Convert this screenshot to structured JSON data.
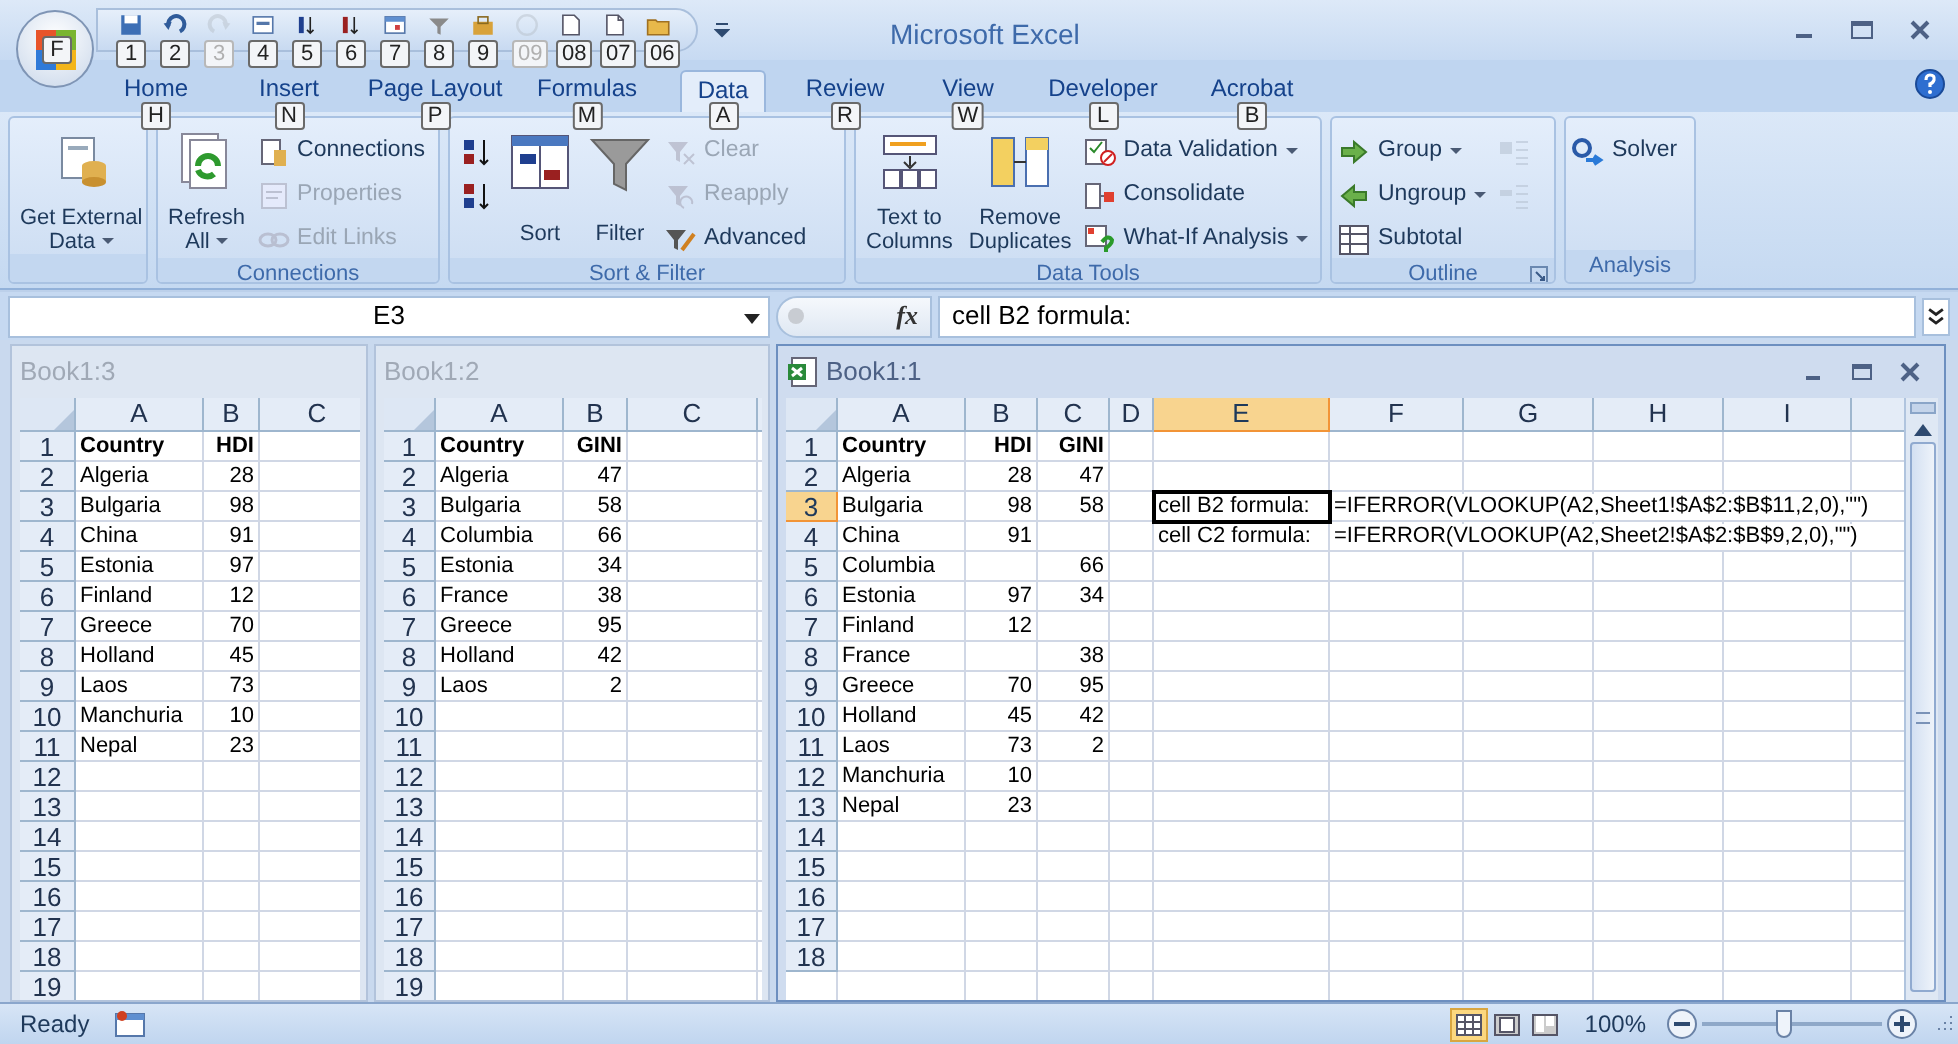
{
  "title_bar": {
    "title": "Microsoft Excel",
    "office_button_keytip": "F",
    "quick_access": [
      {
        "keytip": "1",
        "disabled": false
      },
      {
        "keytip": "2",
        "disabled": false
      },
      {
        "keytip": "3",
        "disabled": true
      },
      {
        "keytip": "4",
        "disabled": false
      },
      {
        "keytip": "5",
        "disabled": false
      },
      {
        "keytip": "6",
        "disabled": false
      },
      {
        "keytip": "7",
        "disabled": false
      },
      {
        "keytip": "8",
        "disabled": false
      },
      {
        "keytip": "9",
        "disabled": false
      },
      {
        "keytip": "09",
        "disabled": true
      },
      {
        "keytip": "08",
        "disabled": false
      },
      {
        "keytip": "07",
        "disabled": false
      },
      {
        "keytip": "06",
        "disabled": false
      }
    ]
  },
  "ribbon": {
    "tabs": [
      {
        "label": "Home",
        "keytip": "H",
        "selected": false
      },
      {
        "label": "Insert",
        "keytip": "N",
        "selected": false
      },
      {
        "label": "Page Layout",
        "keytip": "P",
        "selected": false
      },
      {
        "label": "Formulas",
        "keytip": "M",
        "selected": false
      },
      {
        "label": "Data",
        "keytip": "A",
        "selected": true
      },
      {
        "label": "Review",
        "keytip": "R",
        "selected": false
      },
      {
        "label": "View",
        "keytip": "W",
        "selected": false
      },
      {
        "label": "Developer",
        "keytip": "L",
        "selected": false
      },
      {
        "label": "Acrobat",
        "keytip": "B",
        "selected": false
      }
    ],
    "groups": [
      {
        "launcher": false,
        "commands": [
          {
            "kind": "large",
            "lines": [
              "Get External",
              "Data"
            ],
            "dropdown": true,
            "disabled": false
          }
        ]
      },
      {
        "label": "Connections",
        "launcher": false,
        "commands": [
          {
            "kind": "large",
            "lines": [
              "Refresh",
              "All"
            ],
            "dropdown": true,
            "disabled": false
          },
          {
            "kind": "small",
            "label": "Connections",
            "dropdown": false,
            "disabled": false
          },
          {
            "kind": "small",
            "label": "Properties",
            "dropdown": false,
            "disabled": true
          },
          {
            "kind": "small",
            "label": "Edit Links",
            "dropdown": false,
            "disabled": true
          }
        ]
      },
      {
        "label": "Sort & Filter",
        "launcher": false,
        "commands": [
          {
            "kind": "icon",
            "disabled": false
          },
          {
            "kind": "icon",
            "disabled": false
          },
          {
            "kind": "large",
            "lines": [
              "Sort"
            ],
            "dropdown": false,
            "disabled": false
          },
          {
            "kind": "large",
            "lines": [
              "Filter"
            ],
            "dropdown": false,
            "disabled": false
          },
          {
            "kind": "small",
            "label": "Clear",
            "dropdown": false,
            "disabled": true
          },
          {
            "kind": "small",
            "label": "Reapply",
            "dropdown": false,
            "disabled": true
          },
          {
            "kind": "small",
            "label": "Advanced",
            "dropdown": false,
            "disabled": false
          }
        ]
      },
      {
        "label": "Data Tools",
        "launcher": false,
        "commands": [
          {
            "kind": "large",
            "lines": [
              "Text to",
              "Columns"
            ],
            "dropdown": false,
            "disabled": false
          },
          {
            "kind": "large",
            "lines": [
              "Remove",
              "Duplicates"
            ],
            "dropdown": false,
            "disabled": false
          },
          {
            "kind": "small",
            "label": "Data Validation",
            "dropdown": true,
            "disabled": false
          },
          {
            "kind": "small",
            "label": "Consolidate",
            "dropdown": false,
            "disabled": false
          },
          {
            "kind": "small",
            "label": "What-If Analysis",
            "dropdown": true,
            "disabled": false
          }
        ]
      },
      {
        "label": "Outline",
        "launcher": true,
        "commands": [
          {
            "kind": "small",
            "label": "Group",
            "dropdown": true,
            "disabled": false
          },
          {
            "kind": "small",
            "label": "Ungroup",
            "dropdown": true,
            "disabled": false
          },
          {
            "kind": "small",
            "label": "Subtotal",
            "dropdown": false,
            "disabled": false
          },
          {
            "kind": "icon",
            "disabled": true
          },
          {
            "kind": "icon",
            "disabled": true
          }
        ]
      },
      {
        "label": "Analysis",
        "launcher": false,
        "commands": [
          {
            "kind": "small",
            "label": "Solver",
            "dropdown": false,
            "disabled": false
          }
        ]
      }
    ]
  },
  "formula_bar": {
    "name_box": "E3",
    "function_label": "fx",
    "formula": "cell B2 formula:"
  },
  "windows": [
    {
      "title": "Book1:3",
      "active": false,
      "columns": [
        {
          "label": "A",
          "selected": false,
          "numeric": false
        },
        {
          "label": "B",
          "selected": false,
          "numeric": true
        },
        {
          "label": "C",
          "selected": false
        }
      ],
      "rows": [
        {
          "number": "1",
          "selected": false,
          "bold": true,
          "cells": [
            "Country",
            "HDI"
          ]
        },
        {
          "number": "2",
          "selected": false,
          "bold": false,
          "cells": [
            "Algeria",
            "28"
          ]
        },
        {
          "number": "3",
          "selected": false,
          "bold": false,
          "cells": [
            "Bulgaria",
            "98"
          ]
        },
        {
          "number": "4",
          "selected": false,
          "bold": false,
          "cells": [
            "China",
            "91"
          ]
        },
        {
          "number": "5",
          "selected": false,
          "bold": false,
          "cells": [
            "Estonia",
            "97"
          ]
        },
        {
          "number": "6",
          "selected": false,
          "bold": false,
          "cells": [
            "Finland",
            "12"
          ]
        },
        {
          "number": "7",
          "selected": false,
          "bold": false,
          "cells": [
            "Greece",
            "70"
          ]
        },
        {
          "number": "8",
          "selected": false,
          "bold": false,
          "cells": [
            "Holland",
            "45"
          ]
        },
        {
          "number": "9",
          "selected": false,
          "bold": false,
          "cells": [
            "Laos",
            "73"
          ]
        },
        {
          "number": "10",
          "selected": false,
          "bold": false,
          "cells": [
            "Manchuria",
            "10"
          ]
        },
        {
          "number": "11",
          "selected": false,
          "bold": false,
          "cells": [
            "Nepal",
            "23"
          ]
        },
        {
          "number": "12",
          "selected": false,
          "cells": []
        },
        {
          "number": "13",
          "selected": false,
          "cells": []
        },
        {
          "number": "14",
          "selected": false,
          "cells": []
        },
        {
          "number": "15",
          "selected": false,
          "cells": []
        },
        {
          "number": "16",
          "selected": false,
          "cells": []
        },
        {
          "number": "17",
          "selected": false,
          "cells": []
        },
        {
          "number": "18",
          "selected": false,
          "cells": []
        },
        {
          "number": "19",
          "selected": false,
          "cells": []
        }
      ]
    },
    {
      "title": "Book1:2",
      "active": false,
      "columns": [
        {
          "label": "A",
          "selected": false,
          "numeric": false
        },
        {
          "label": "B",
          "selected": false,
          "numeric": true
        },
        {
          "label": "C",
          "selected": false
        }
      ],
      "rows": [
        {
          "number": "1",
          "selected": false,
          "bold": true,
          "cells": [
            "Country",
            "GINI"
          ]
        },
        {
          "number": "2",
          "selected": false,
          "bold": false,
          "cells": [
            "Algeria",
            "47"
          ]
        },
        {
          "number": "3",
          "selected": false,
          "bold": false,
          "cells": [
            "Bulgaria",
            "58"
          ]
        },
        {
          "number": "4",
          "selected": false,
          "bold": false,
          "cells": [
            "Columbia",
            "66"
          ]
        },
        {
          "number": "5",
          "selected": false,
          "bold": false,
          "cells": [
            "Estonia",
            "34"
          ]
        },
        {
          "number": "6",
          "selected": false,
          "bold": false,
          "cells": [
            "France",
            "38"
          ]
        },
        {
          "number": "7",
          "selected": false,
          "bold": false,
          "cells": [
            "Greece",
            "95"
          ]
        },
        {
          "number": "8",
          "selected": false,
          "bold": false,
          "cells": [
            "Holland",
            "42"
          ]
        },
        {
          "number": "9",
          "selected": false,
          "bold": false,
          "cells": [
            "Laos",
            "2"
          ]
        },
        {
          "number": "10",
          "selected": false,
          "cells": []
        },
        {
          "number": "11",
          "selected": false,
          "cells": []
        },
        {
          "number": "12",
          "selected": false,
          "cells": []
        },
        {
          "number": "13",
          "selected": false,
          "cells": []
        },
        {
          "number": "14",
          "selected": false,
          "cells": []
        },
        {
          "number": "15",
          "selected": false,
          "cells": []
        },
        {
          "number": "16",
          "selected": false,
          "cells": []
        },
        {
          "number": "17",
          "selected": false,
          "cells": []
        },
        {
          "number": "18",
          "selected": false,
          "cells": []
        },
        {
          "number": "19",
          "selected": false,
          "cells": []
        }
      ]
    },
    {
      "title": "Book1:1",
      "active": true,
      "columns": [
        {
          "label": "A",
          "selected": false,
          "numeric": false
        },
        {
          "label": "B",
          "selected": false,
          "numeric": true
        },
        {
          "label": "C",
          "selected": false,
          "numeric": true
        },
        {
          "label": "D",
          "selected": false
        },
        {
          "label": "E",
          "selected": true,
          "numeric": false
        },
        {
          "label": "F",
          "selected": false,
          "numeric": false
        },
        {
          "label": "G",
          "selected": false
        },
        {
          "label": "H",
          "selected": false
        },
        {
          "label": "I",
          "selected": false
        }
      ],
      "rows": [
        {
          "number": "1",
          "selected": false,
          "bold": true,
          "cells": [
            "Country",
            "HDI",
            "GINI"
          ]
        },
        {
          "number": "2",
          "selected": false,
          "bold": false,
          "cells": [
            "Algeria",
            "28",
            "47"
          ]
        },
        {
          "number": "3",
          "selected": true,
          "bold": false,
          "cells": [
            "Bulgaria",
            "98",
            "58",
            null,
            "cell B2 formula:",
            "=IFERROR(VLOOKUP(A2,Sheet1!$A$2:$B$11,2,0),\"\")"
          ]
        },
        {
          "number": "4",
          "selected": false,
          "bold": false,
          "cells": [
            "China",
            "91",
            null,
            null,
            "cell C2 formula:",
            "=IFERROR(VLOOKUP(A2,Sheet2!$A$2:$B$9,2,0),\"\")"
          ]
        },
        {
          "number": "5",
          "selected": false,
          "bold": false,
          "cells": [
            "Columbia",
            null,
            "66"
          ]
        },
        {
          "number": "6",
          "selected": false,
          "bold": false,
          "cells": [
            "Estonia",
            "97",
            "34"
          ]
        },
        {
          "number": "7",
          "selected": false,
          "bold": false,
          "cells": [
            "Finland",
            "12"
          ]
        },
        {
          "number": "8",
          "selected": false,
          "bold": false,
          "cells": [
            "France",
            null,
            "38"
          ]
        },
        {
          "number": "9",
          "selected": false,
          "bold": false,
          "cells": [
            "Greece",
            "70",
            "95"
          ]
        },
        {
          "number": "10",
          "selected": false,
          "bold": false,
          "cells": [
            "Holland",
            "45",
            "42"
          ]
        },
        {
          "number": "11",
          "selected": false,
          "bold": false,
          "cells": [
            "Laos",
            "73",
            "2"
          ]
        },
        {
          "number": "12",
          "selected": false,
          "bold": false,
          "cells": [
            "Manchuria",
            "10"
          ]
        },
        {
          "number": "13",
          "selected": false,
          "bold": false,
          "cells": [
            "Nepal",
            "23"
          ]
        },
        {
          "number": "14",
          "selected": false,
          "cells": []
        },
        {
          "number": "15",
          "selected": false,
          "cells": []
        },
        {
          "number": "16",
          "selected": false,
          "cells": []
        },
        {
          "number": "17",
          "selected": false,
          "cells": []
        },
        {
          "number": "18",
          "selected": false,
          "cells": []
        }
      ]
    }
  ],
  "status_bar": {
    "status": "Ready",
    "views": [
      {
        "kind": "normal",
        "selected": true
      },
      {
        "kind": "page_layout",
        "selected": false
      },
      {
        "kind": "page_break",
        "selected": false
      }
    ],
    "zoom": {
      "reading": "100%",
      "level": 0.45
    }
  }
}
